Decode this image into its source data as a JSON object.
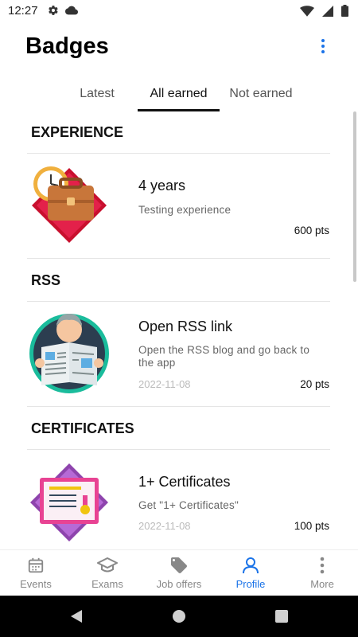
{
  "status_bar": {
    "time": "12:27"
  },
  "header": {
    "title": "Badges"
  },
  "tabs": [
    {
      "label": "Latest"
    },
    {
      "label": "All earned"
    },
    {
      "label": "Not earned"
    }
  ],
  "sections": [
    {
      "title": "EXPERIENCE",
      "badge": {
        "name": "4 years",
        "description": "Testing experience",
        "date": "",
        "points": "600 pts",
        "icon": "briefcase-clock-icon"
      }
    },
    {
      "title": "RSS",
      "badge": {
        "name": "Open RSS link",
        "description": "Open the RSS blog and go back to the app",
        "date": "2022-11-08",
        "points": "20 pts",
        "icon": "newspaper-reader-icon"
      }
    },
    {
      "title": "CERTIFICATES",
      "badge": {
        "name": "1+ Certificates",
        "description": "Get \"1+ Certificates\"",
        "date": "2022-11-08",
        "points": "100 pts",
        "icon": "certificate-icon"
      }
    }
  ],
  "bottom_nav": [
    {
      "label": "Events",
      "icon": "calendar-icon"
    },
    {
      "label": "Exams",
      "icon": "graduation-cap-icon"
    },
    {
      "label": "Job offers",
      "icon": "tag-icon"
    },
    {
      "label": "Profile",
      "icon": "person-icon"
    },
    {
      "label": "More",
      "icon": "more-vertical-icon"
    }
  ],
  "colors": {
    "accent": "#1a73e8",
    "nav_inactive": "#888888"
  }
}
